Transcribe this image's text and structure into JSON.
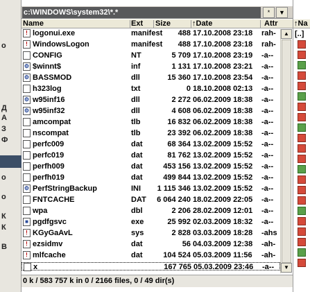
{
  "left_strip": {
    "letters": [
      "о",
      "Д",
      "А",
      "З",
      "Ф",
      "о",
      "о",
      "К",
      "К",
      "В"
    ]
  },
  "path_bar": {
    "path": "c:\\WINDOWS\\system32\\*.*",
    "star_button": "*",
    "history_button": "▼"
  },
  "columns": {
    "name": "Name",
    "ext": "Ext",
    "size": "Size",
    "date": "↑Date",
    "attr": "Attr"
  },
  "files": [
    {
      "name": "logonui.exe",
      "ext": "manifest",
      "size": "488",
      "date": "17.10.2008 23:18",
      "attr": "rah-",
      "icon": "manifest-icon"
    },
    {
      "name": "WindowsLogon",
      "ext": "manifest",
      "size": "488",
      "date": "17.10.2008 23:18",
      "attr": "rah-",
      "icon": "manifest-icon"
    },
    {
      "name": "CONFIG",
      "ext": "NT",
      "size": "5 709",
      "date": "17.10.2008 23:19",
      "attr": "-a--",
      "icon": "file-icon"
    },
    {
      "name": "$winnt$",
      "ext": "inf",
      "size": "1 131",
      "date": "17.10.2008 23:21",
      "attr": "-a--",
      "icon": "settings-file-icon"
    },
    {
      "name": "BASSMOD",
      "ext": "dll",
      "size": "15 360",
      "date": "17.10.2008 23:54",
      "attr": "-a--",
      "icon": "dll-icon"
    },
    {
      "name": "h323log",
      "ext": "txt",
      "size": "0",
      "date": "18.10.2008 02:13",
      "attr": "-a--",
      "icon": "text-file-icon"
    },
    {
      "name": "w95inf16",
      "ext": "dll",
      "size": "2 272",
      "date": "06.02.2009 18:38",
      "attr": "-a--",
      "icon": "dll-icon"
    },
    {
      "name": "w95inf32",
      "ext": "dll",
      "size": "4 608",
      "date": "06.02.2009 18:38",
      "attr": "-a--",
      "icon": "dll-icon"
    },
    {
      "name": "amcompat",
      "ext": "tlb",
      "size": "16 832",
      "date": "06.02.2009 18:38",
      "attr": "-a--",
      "icon": "file-icon"
    },
    {
      "name": "nscompat",
      "ext": "tlb",
      "size": "23 392",
      "date": "06.02.2009 18:38",
      "attr": "-a--",
      "icon": "file-icon"
    },
    {
      "name": "perfc009",
      "ext": "dat",
      "size": "68 364",
      "date": "13.02.2009 15:52",
      "attr": "-a--",
      "icon": "file-icon"
    },
    {
      "name": "perfc019",
      "ext": "dat",
      "size": "81 762",
      "date": "13.02.2009 15:52",
      "attr": "-a--",
      "icon": "file-icon"
    },
    {
      "name": "perfh009",
      "ext": "dat",
      "size": "453 156",
      "date": "13.02.2009 15:52",
      "attr": "-a--",
      "icon": "file-icon"
    },
    {
      "name": "perfh019",
      "ext": "dat",
      "size": "499 844",
      "date": "13.02.2009 15:52",
      "attr": "-a--",
      "icon": "file-icon"
    },
    {
      "name": "PerfStringBackup",
      "ext": "INI",
      "size": "1 115 346",
      "date": "13.02.2009 15:52",
      "attr": "-a--",
      "icon": "settings-file-icon"
    },
    {
      "name": "FNTCACHE",
      "ext": "DAT",
      "size": "6 064 240",
      "date": "18.02.2009 22:05",
      "attr": "-a--",
      "icon": "file-icon"
    },
    {
      "name": "wpa",
      "ext": "dbl",
      "size": "2 206",
      "date": "28.02.2009 12:01",
      "attr": "-a--",
      "icon": "file-icon"
    },
    {
      "name": "pgdfgsvc",
      "ext": "exe",
      "size": "25 992",
      "date": "02.03.2009 18:32",
      "attr": "-a--",
      "icon": "exe-icon"
    },
    {
      "name": "KGyGaAvL",
      "ext": "sys",
      "size": "2 828",
      "date": "03.03.2009 18:28",
      "attr": "-ahs",
      "icon": "manifest-icon"
    },
    {
      "name": "ezsidmv",
      "ext": "dat",
      "size": "56",
      "date": "04.03.2009 12:38",
      "attr": "-ah-",
      "icon": "manifest-icon"
    },
    {
      "name": "mlfcache",
      "ext": "dat",
      "size": "104 524",
      "date": "05.03.2009 11:56",
      "attr": "-ah-",
      "icon": "manifest-icon"
    },
    {
      "name": "x",
      "ext": "",
      "size": "167 765",
      "date": "05.03.2009 23:46",
      "attr": "-a--",
      "icon": "file-icon"
    }
  ],
  "status_bar": "0 k / 583 757 k in 0 / 2166 files, 0 / 49 dir(s)",
  "right_panel": {
    "header": "↑Na",
    "top_item": "[..]"
  }
}
